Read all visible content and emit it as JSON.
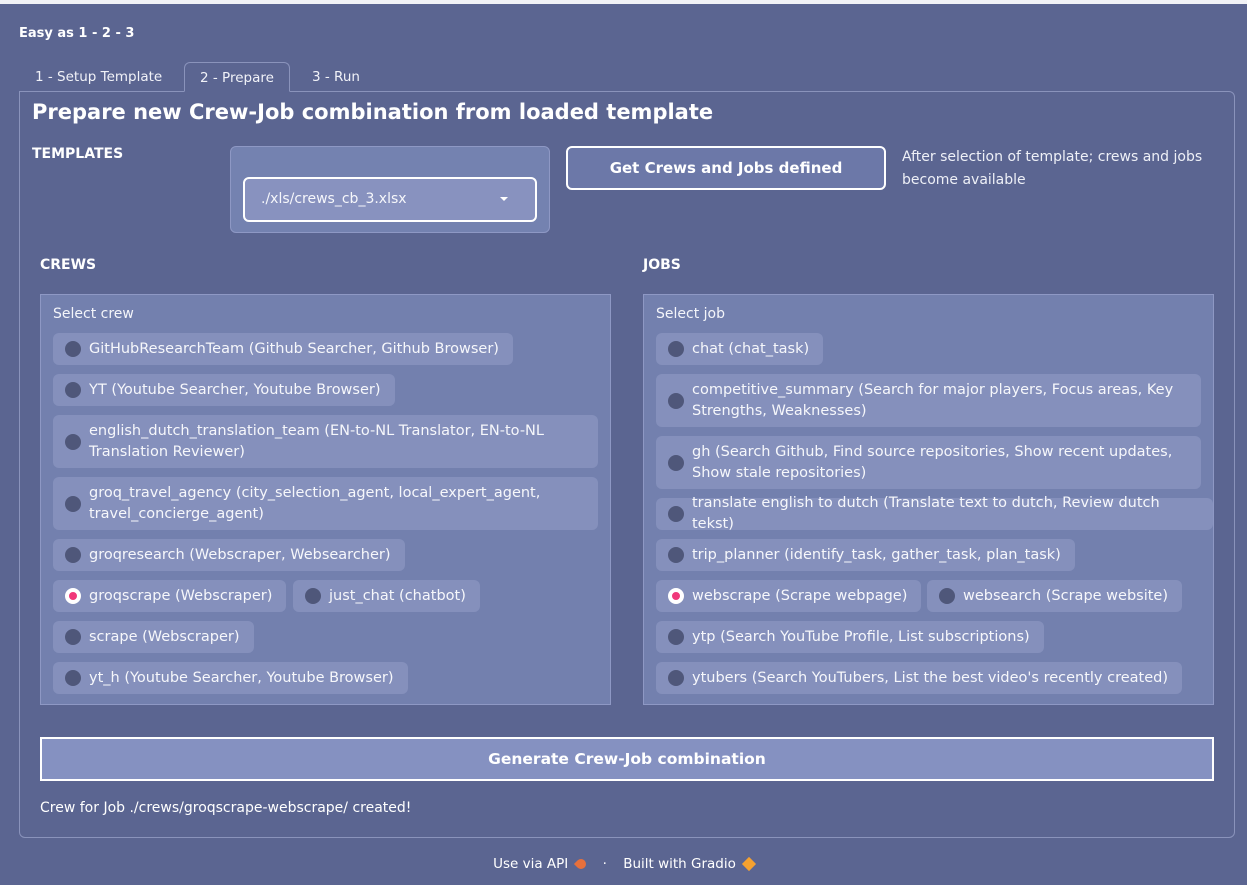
{
  "app_label": "Easy as 1 - 2 - 3",
  "tabs": [
    {
      "label": "1 - Setup Template"
    },
    {
      "label": "2 - Prepare"
    },
    {
      "label": "3 - Run"
    }
  ],
  "page_title": "Prepare new Crew-Job combination from loaded template",
  "templates": {
    "label": "TEMPLATES",
    "selected": "./xls/crews_cb_3.xlsx"
  },
  "get_button_label": "Get Crews and Jobs defined",
  "help_text": "After selection of template; crews and jobs become available",
  "crews": {
    "section_label": "CREWS",
    "radio_title": "Select crew",
    "options": [
      "GitHubResearchTeam (Github Searcher, Github Browser)",
      "YT (Youtube Searcher, Youtube Browser)",
      "english_dutch_translation_team (EN-to-NL Translator, EN-to-NL Translation Reviewer)",
      "groq_travel_agency (city_selection_agent, local_expert_agent, travel_concierge_agent)",
      "groqresearch (Webscraper, Websearcher)",
      "groqscrape (Webscraper)",
      "just_chat (chatbot)",
      "scrape (Webscraper)",
      "yt_h (Youtube Searcher, Youtube Browser)"
    ],
    "selected": "groqscrape (Webscraper)"
  },
  "jobs": {
    "section_label": "JOBS",
    "radio_title": "Select job",
    "options": [
      "chat (chat_task)",
      "competitive_summary (Search for major players, Focus areas, Key Strengths, Weaknesses)",
      "gh (Search Github, Find source repositories, Show recent updates, Show stale repositories)",
      "translate english to dutch (Translate text to dutch, Review dutch tekst)",
      "trip_planner (identify_task, gather_task, plan_task)",
      "webscrape (Scrape webpage)",
      "websearch (Scrape website)",
      "ytp (Search YouTube Profile, List subscriptions)",
      "ytubers (Search YouTubers, List the best video's recently created)"
    ],
    "selected": "webscrape (Scrape webpage)"
  },
  "generate_button_label": "Generate Crew-Job combination",
  "status_text": "Crew for Job ./crews/groqscrape-webscrape/ created!",
  "footer": {
    "api_link": "Use via API",
    "separator": "·",
    "built_with": "Built with Gradio"
  },
  "colors": {
    "background": "#5b6591",
    "selected_radio": "#f0387a",
    "chip": "#8590bc"
  }
}
